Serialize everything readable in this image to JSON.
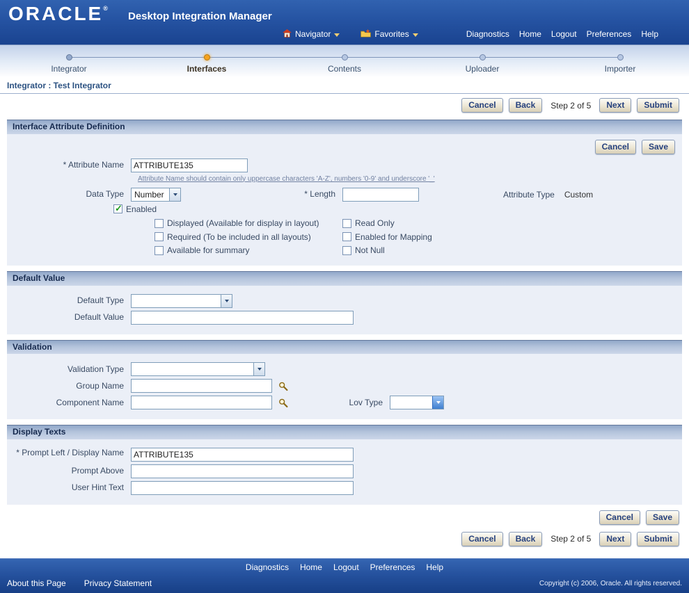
{
  "header": {
    "logo": "ORACLE",
    "registered": "®",
    "app_title": "Desktop Integration Manager",
    "navigator": "Navigator",
    "favorites": "Favorites",
    "links": [
      "Diagnostics",
      "Home",
      "Logout",
      "Preferences",
      "Help"
    ]
  },
  "train": {
    "steps": [
      {
        "label": "Integrator",
        "state": "visited"
      },
      {
        "label": "Interfaces",
        "state": "current"
      },
      {
        "label": "Contents",
        "state": "future"
      },
      {
        "label": "Uploader",
        "state": "future"
      },
      {
        "label": "Importer",
        "state": "future"
      }
    ]
  },
  "breadcrumb": {
    "text": "Integrator : Test Integrator"
  },
  "wizard": {
    "cancel": "Cancel",
    "back": "Back",
    "step_text": "Step 2 of 5",
    "next": "Next",
    "submit": "Submit"
  },
  "attribute_section": {
    "title": "Interface Attribute Definition",
    "cancel": "Cancel",
    "save": "Save",
    "attribute_name": {
      "label": "* Attribute Name",
      "value": "ATTRIBUTE135",
      "hint": "Attribute Name should contain only uppercase characters 'A-Z', numbers '0-9' and underscore '_'"
    },
    "data_type": {
      "label": "Data Type",
      "value": "Number"
    },
    "length": {
      "label": "* Length",
      "value": ""
    },
    "attribute_type": {
      "label": "Attribute Type",
      "value": "Custom"
    },
    "enabled": {
      "label": "Enabled",
      "checked": true
    },
    "options_left": [
      "Displayed (Available for display in layout)",
      "Required (To be included in all layouts)",
      "Available for summary"
    ],
    "options_right": [
      "Read Only",
      "Enabled for Mapping",
      "Not Null"
    ]
  },
  "default_section": {
    "title": "Default Value",
    "default_type_label": "Default Type",
    "default_type_value": "",
    "default_value_label": "Default Value",
    "default_value_value": ""
  },
  "validation_section": {
    "title": "Validation",
    "validation_type_label": "Validation Type",
    "validation_type_value": "",
    "group_name_label": "Group Name",
    "group_name_value": "",
    "component_name_label": "Component Name",
    "component_name_value": "",
    "lov_type_label": "Lov Type",
    "lov_type_value": ""
  },
  "display_section": {
    "title": "Display Texts",
    "prompt_left": {
      "label": "* Prompt Left / Display Name",
      "value": "ATTRIBUTE135"
    },
    "prompt_above": {
      "label": "Prompt Above",
      "value": ""
    },
    "user_hint": {
      "label": "User Hint Text",
      "value": ""
    },
    "cancel": "Cancel",
    "save": "Save"
  },
  "footer": {
    "links": [
      "Diagnostics",
      "Home",
      "Logout",
      "Preferences",
      "Help"
    ],
    "about": "About this Page",
    "privacy": "Privacy Statement",
    "copyright": "Copyright (c) 2006, Oracle. All rights reserved."
  }
}
